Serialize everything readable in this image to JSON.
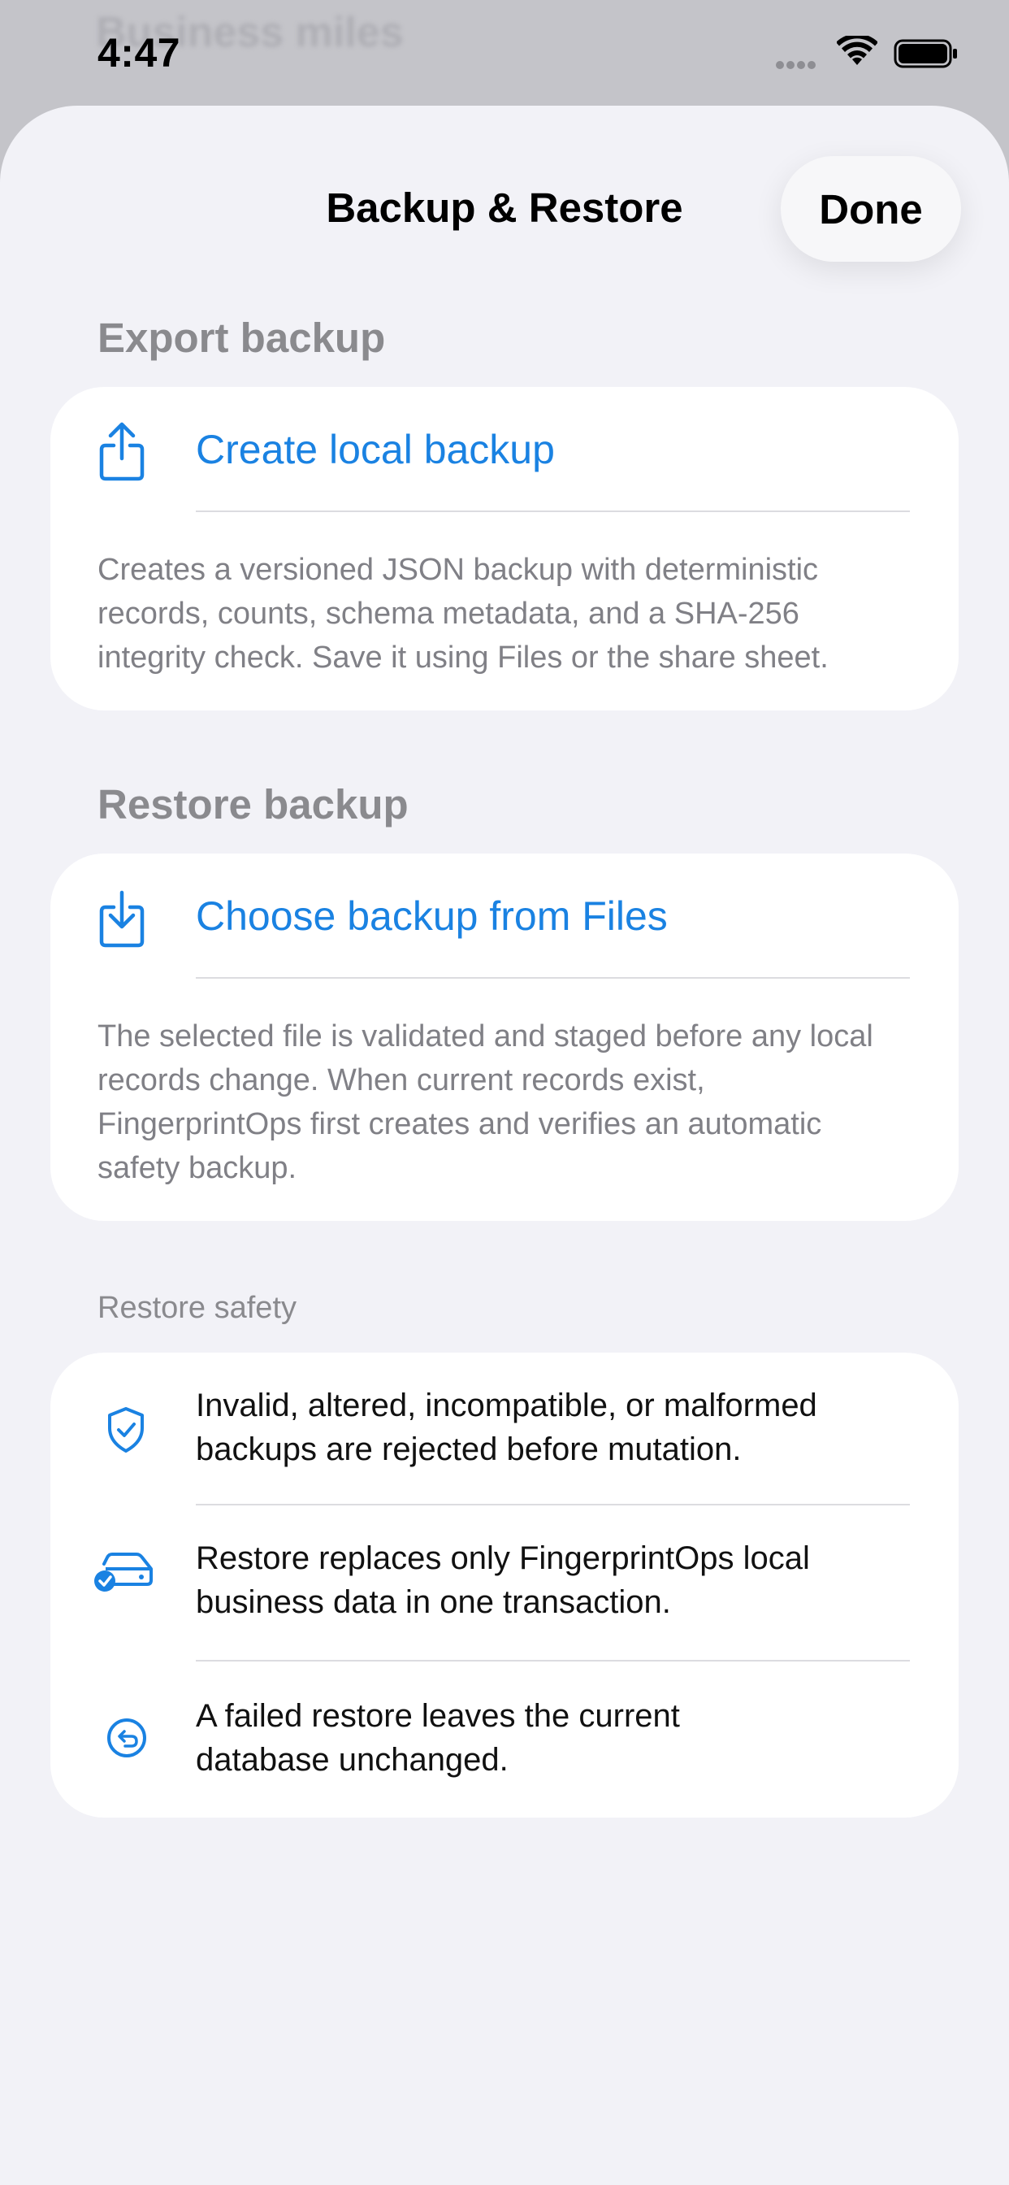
{
  "background": {
    "ghost_title": "Business miles"
  },
  "status_bar": {
    "time": "4:47"
  },
  "nav": {
    "title": "Backup & Restore",
    "done_label": "Done"
  },
  "export": {
    "header": "Export backup",
    "action_label": "Create local backup",
    "action_icon": "share-icon",
    "description": "Creates a versioned JSON backup with deterministic records, counts, schema metadata, and a SHA-256 integrity check. Save it using Files or the share sheet."
  },
  "restore": {
    "header": "Restore backup",
    "action_label": "Choose backup from Files",
    "action_icon": "download-icon",
    "description": "The selected file is validated and staged before any local records change. When current records exist, FingerprintOps first creates and verifies an automatic safety backup."
  },
  "safety": {
    "header": "Restore safety",
    "items": [
      {
        "icon": "shield-check-icon",
        "text": "Invalid, altered, incompatible, or malformed backups are rejected before mutation."
      },
      {
        "icon": "drive-check-icon",
        "text": "Restore replaces only FingerprintOps local business data in one transaction."
      },
      {
        "icon": "undo-circle-icon",
        "text": "A failed restore leaves the current database unchanged."
      }
    ]
  },
  "colors": {
    "accent": "#1a82e2",
    "sheet_background": "#f2f2f7",
    "card_background": "#ffffff",
    "secondary_text": "#8a8a8e"
  }
}
